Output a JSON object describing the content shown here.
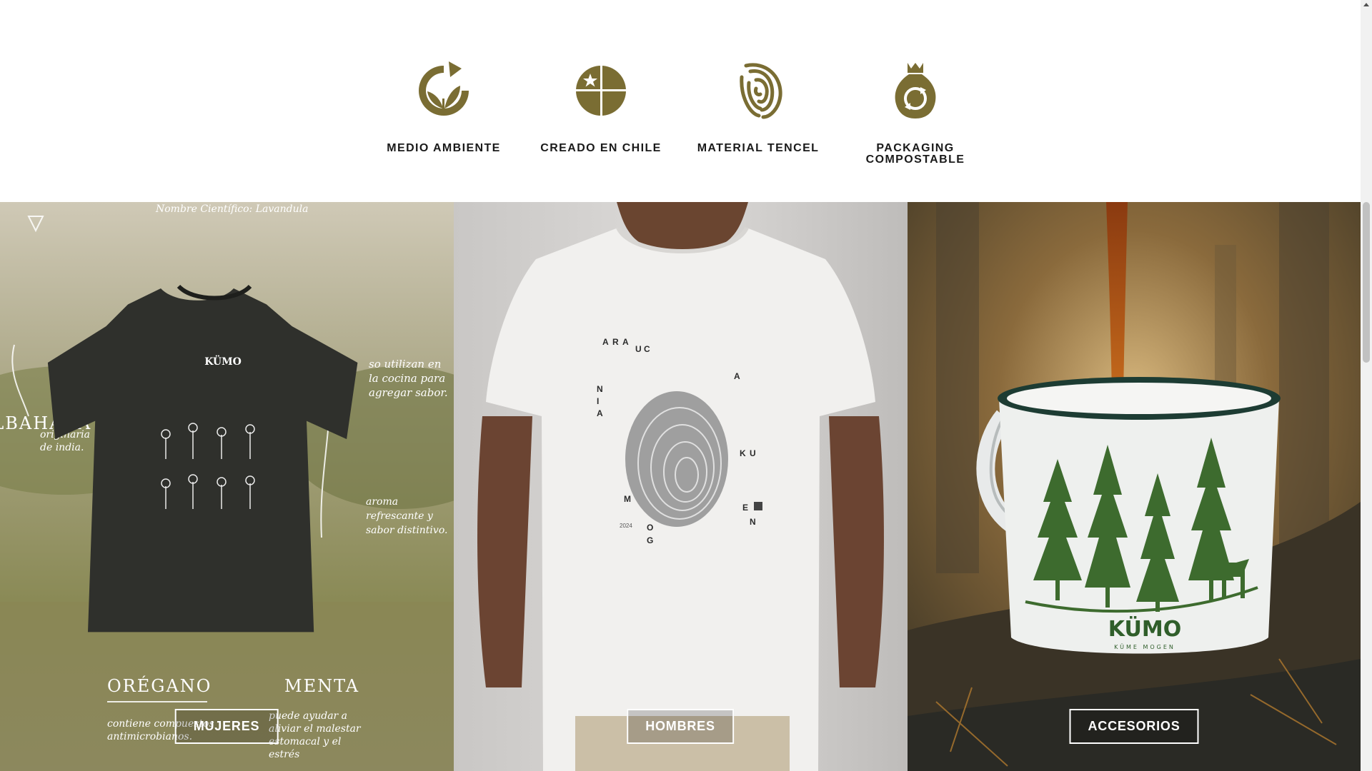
{
  "features": [
    {
      "label": "MEDIO AMBIENTE",
      "icon": "leaf-recycle-icon"
    },
    {
      "label": "CREADO EN CHILE",
      "icon": "chile-flag-icon"
    },
    {
      "label": "MATERIAL TENCEL",
      "icon": "fingerprint-icon"
    },
    {
      "label": "PACKAGING COMPOSTABLE",
      "icon": "compost-bag-icon"
    }
  ],
  "categories": [
    {
      "label": "MUJERES"
    },
    {
      "label": "HOMBRES"
    },
    {
      "label": "ACCESORIOS"
    }
  ],
  "artwork": {
    "tshirt_brand": "KÜMO",
    "herb_scientific": "Nombre Científico: Lavandula",
    "herb_notes": [
      "so utilizan en",
      "la cocina para",
      "agregar sabor.",
      "originaria",
      "de india.",
      "aroma",
      "refrescante y",
      "sabor distintivo.",
      "contiene compuestos",
      "antimicrobianos.",
      "puede ayudar a",
      "aliviar el malestar",
      "estomacal y el",
      "estrés"
    ],
    "herb_names": [
      "ORÉGANO",
      "MENTA",
      "ALBAHACA"
    ],
    "tree_letters": [
      "A",
      "R",
      "A",
      "U",
      "C",
      "A",
      "N",
      "I",
      "A",
      "K",
      "U",
      "M",
      "O",
      "G",
      "E",
      "N"
    ],
    "tree_year": "2024",
    "mug_brand": "KÜMO",
    "mug_tagline": "KÜME MOGEN"
  },
  "colors": {
    "icon_olive": "#7a6d33",
    "label_text": "#1a1a1a",
    "cta_border": "#ffffff"
  }
}
